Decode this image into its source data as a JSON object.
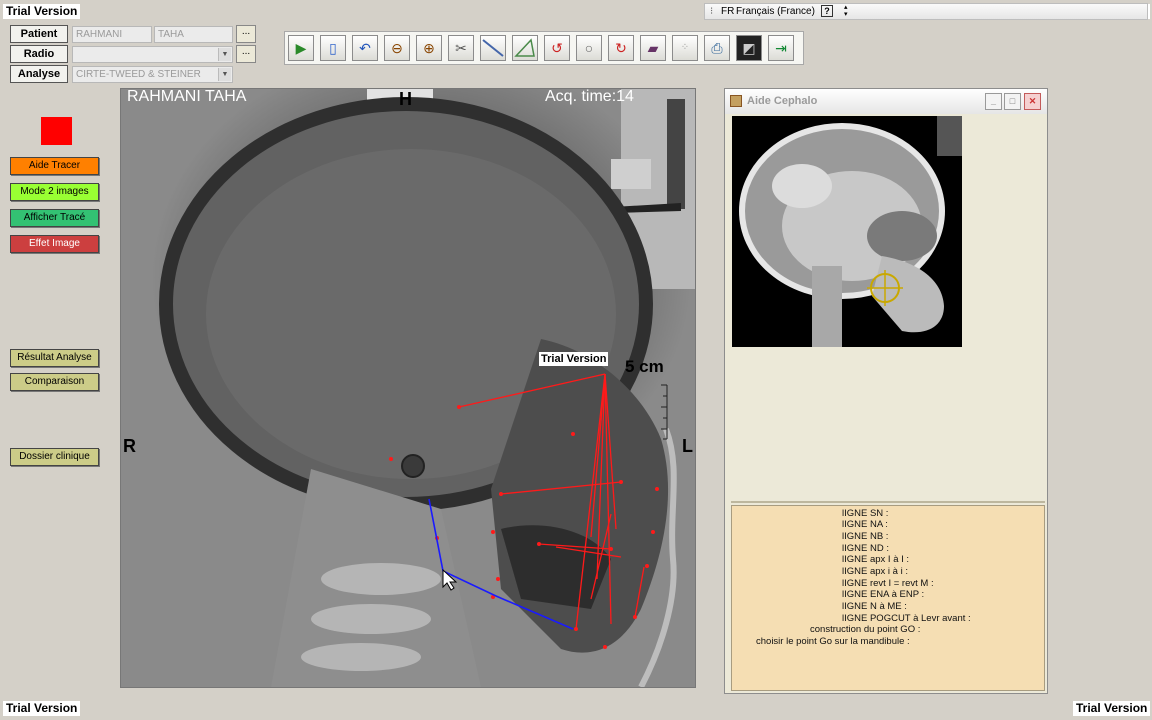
{
  "trial_label": "Trial Version",
  "language_bar": {
    "code": "FR",
    "language": "Français (France)",
    "help": "?"
  },
  "patient_panel": {
    "patient_label": "Patient",
    "radio_label": "Radio",
    "analyse_label": "Analyse",
    "last_name": "RAHMANI",
    "first_name": "TAHA",
    "radio_value": "",
    "analyse_value": "CIRTE-TWEED & STEINER",
    "browse_label": "..."
  },
  "toolbar": {
    "tools": [
      "play-icon",
      "new-page-icon",
      "undo-icon",
      "zoom-out-icon",
      "zoom-in-icon",
      "tools-icon",
      "ruler-icon",
      "triangle-icon",
      "rotate-left-icon",
      "circle-icon",
      "rotate-right-icon",
      "book-icon",
      "noise-icon",
      "print-icon",
      "image-icon",
      "exit-icon"
    ]
  },
  "sidebar": {
    "indicator_color": "#ff0000",
    "buttons": [
      {
        "label": "Aide Tracer",
        "color": "#ff8000"
      },
      {
        "label": "Mode 2 images",
        "color": "#99ff33"
      },
      {
        "label": "Afficher Tracé",
        "color": "#33c173"
      },
      {
        "label": "Effet Image",
        "color": "#cc3f3f"
      },
      {
        "label": "Résultat Analyse",
        "color": "#cccc88"
      },
      {
        "label": "Comparaison",
        "color": "#cccc88"
      },
      {
        "label": "Dossier clinique",
        "color": "#cccc88"
      }
    ]
  },
  "xray": {
    "patient_name": "RAHMANI TAHA",
    "acq_time": "Acq. time:14",
    "top_marker": "H",
    "left_marker": "R",
    "right_marker": "L",
    "scale_label": "5 cm",
    "trial_overlay": "Trial Version",
    "trace_color": "#ff1a1a",
    "gonial_color": "#1a1aff"
  },
  "aide_cephalo": {
    "title": "Aide Cephalo",
    "minimize": "_",
    "maximize": "□",
    "close": "✕",
    "instructions": [
      "lIGNE SN :",
      "lIGNE NA :",
      "lIGNE NB :",
      "lIGNE ND :",
      "lIGNE  apx I à I :",
      "lIGNE  apx i à i :",
      "lIGNE  revt I = revt M :",
      "lIGNE  ENA à ENP :",
      "lIGNE  N à ME :",
      "lIGNE  POGCUT à Levr avant :",
      "construction du point GO :",
      "choisir le point Go sur la mandibule :"
    ]
  }
}
